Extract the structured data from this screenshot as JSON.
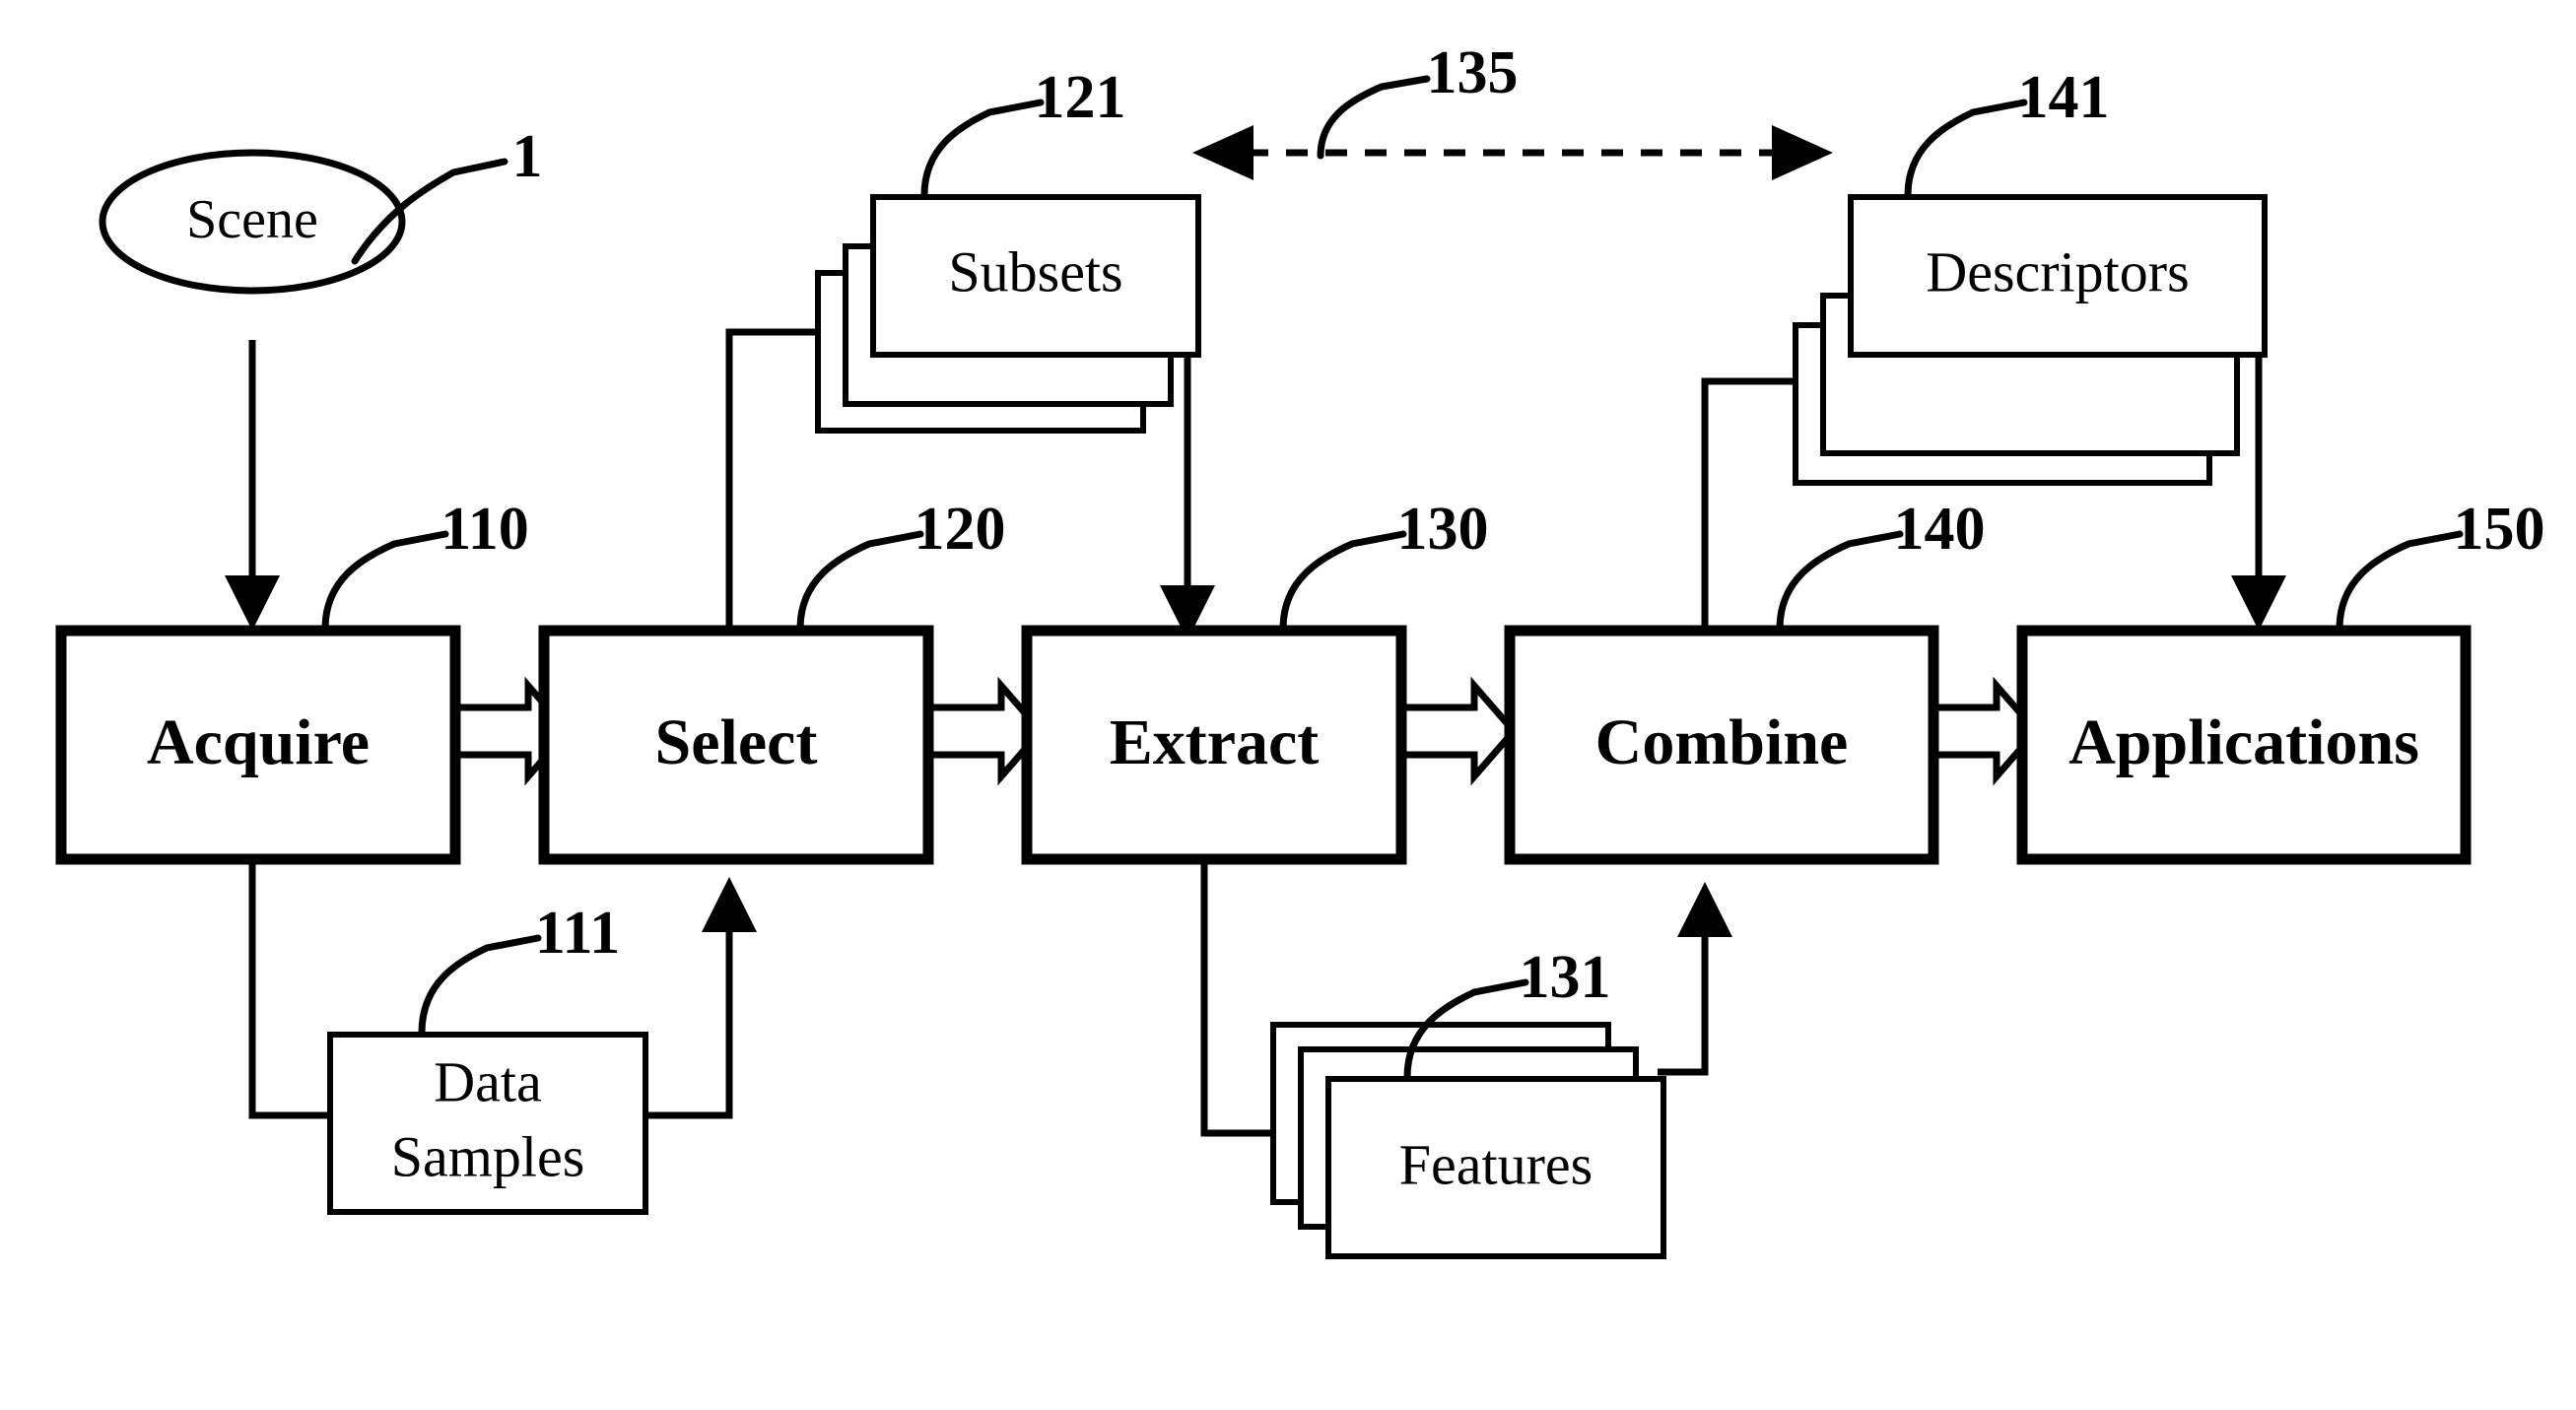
{
  "figure": {
    "type": "patent-flow-diagram",
    "background_color": "#ffffff",
    "line_color": "#000000"
  },
  "nodes": {
    "scene": {
      "label": "Scene",
      "ref": "1",
      "shape": "ellipse"
    },
    "acquire": {
      "label": "Acquire",
      "ref": "110",
      "shape": "process-box"
    },
    "select": {
      "label": "Select",
      "ref": "120",
      "shape": "process-box"
    },
    "extract": {
      "label": "Extract",
      "ref": "130",
      "shape": "process-box"
    },
    "combine": {
      "label": "Combine",
      "ref": "140",
      "shape": "process-box"
    },
    "applications": {
      "label": "Applications",
      "ref": "150",
      "shape": "process-box"
    },
    "data_samples": {
      "label_line1": "Data",
      "label_line2": "Samples",
      "ref": "111",
      "shape": "data-box"
    },
    "subsets": {
      "label": "Subsets",
      "ref": "121",
      "shape": "stacked-data-box"
    },
    "features": {
      "label": "Features",
      "ref": "131",
      "shape": "stacked-data-box"
    },
    "descriptors": {
      "label": "Descriptors",
      "ref": "141",
      "shape": "stacked-data-box"
    }
  },
  "edges": {
    "matching_link": {
      "ref": "135",
      "style": "dashed",
      "arrows": "both",
      "from": "descriptors",
      "to": "subsets"
    }
  },
  "refs": [
    "1",
    "110",
    "111",
    "120",
    "121",
    "130",
    "131",
    "135",
    "140",
    "141",
    "150"
  ]
}
